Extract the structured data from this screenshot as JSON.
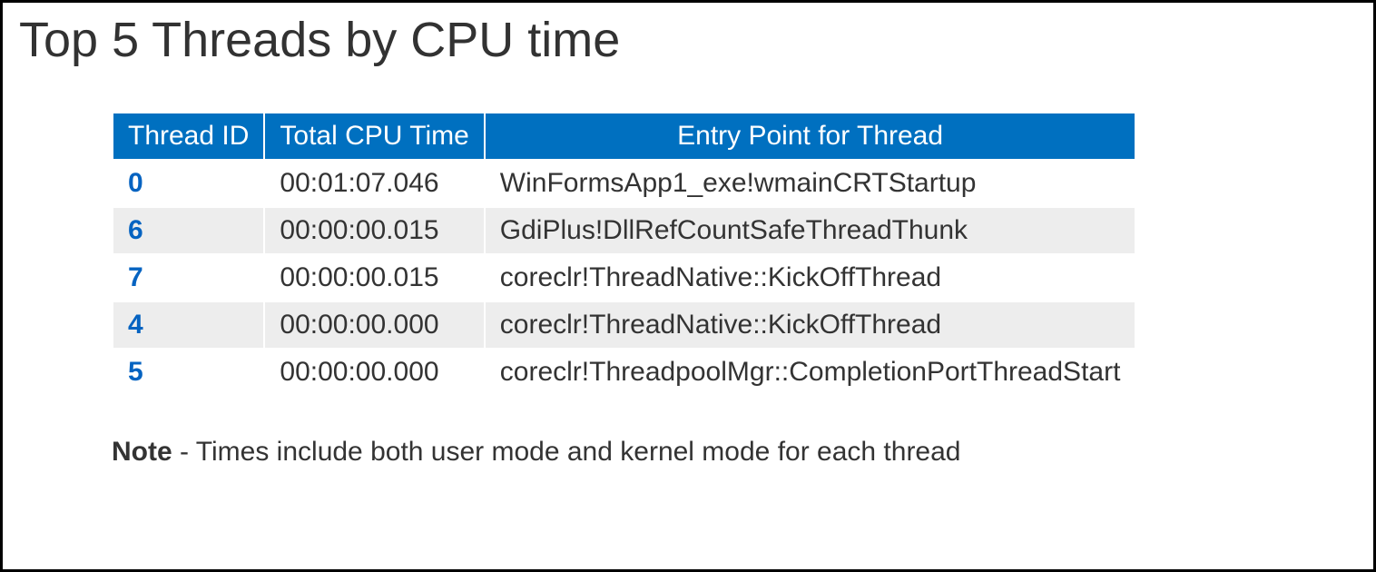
{
  "title": "Top 5 Threads by CPU time",
  "table": {
    "headers": {
      "thread_id": "Thread ID",
      "cpu_time": "Total CPU Time",
      "entry_point": "Entry Point for Thread"
    },
    "rows": [
      {
        "thread_id": "0",
        "cpu_time": "00:01:07.046",
        "entry_point": "WinFormsApp1_exe!wmainCRTStartup"
      },
      {
        "thread_id": "6",
        "cpu_time": "00:00:00.015",
        "entry_point": "GdiPlus!DllRefCountSafeThreadThunk"
      },
      {
        "thread_id": "7",
        "cpu_time": "00:00:00.015",
        "entry_point": "coreclr!ThreadNative::KickOffThread"
      },
      {
        "thread_id": "4",
        "cpu_time": "00:00:00.000",
        "entry_point": "coreclr!ThreadNative::KickOffThread"
      },
      {
        "thread_id": "5",
        "cpu_time": "00:00:00.000",
        "entry_point": "coreclr!ThreadpoolMgr::CompletionPortThreadStart"
      }
    ]
  },
  "note": {
    "label": "Note",
    "text": " - Times include both user mode and kernel mode for each thread"
  }
}
